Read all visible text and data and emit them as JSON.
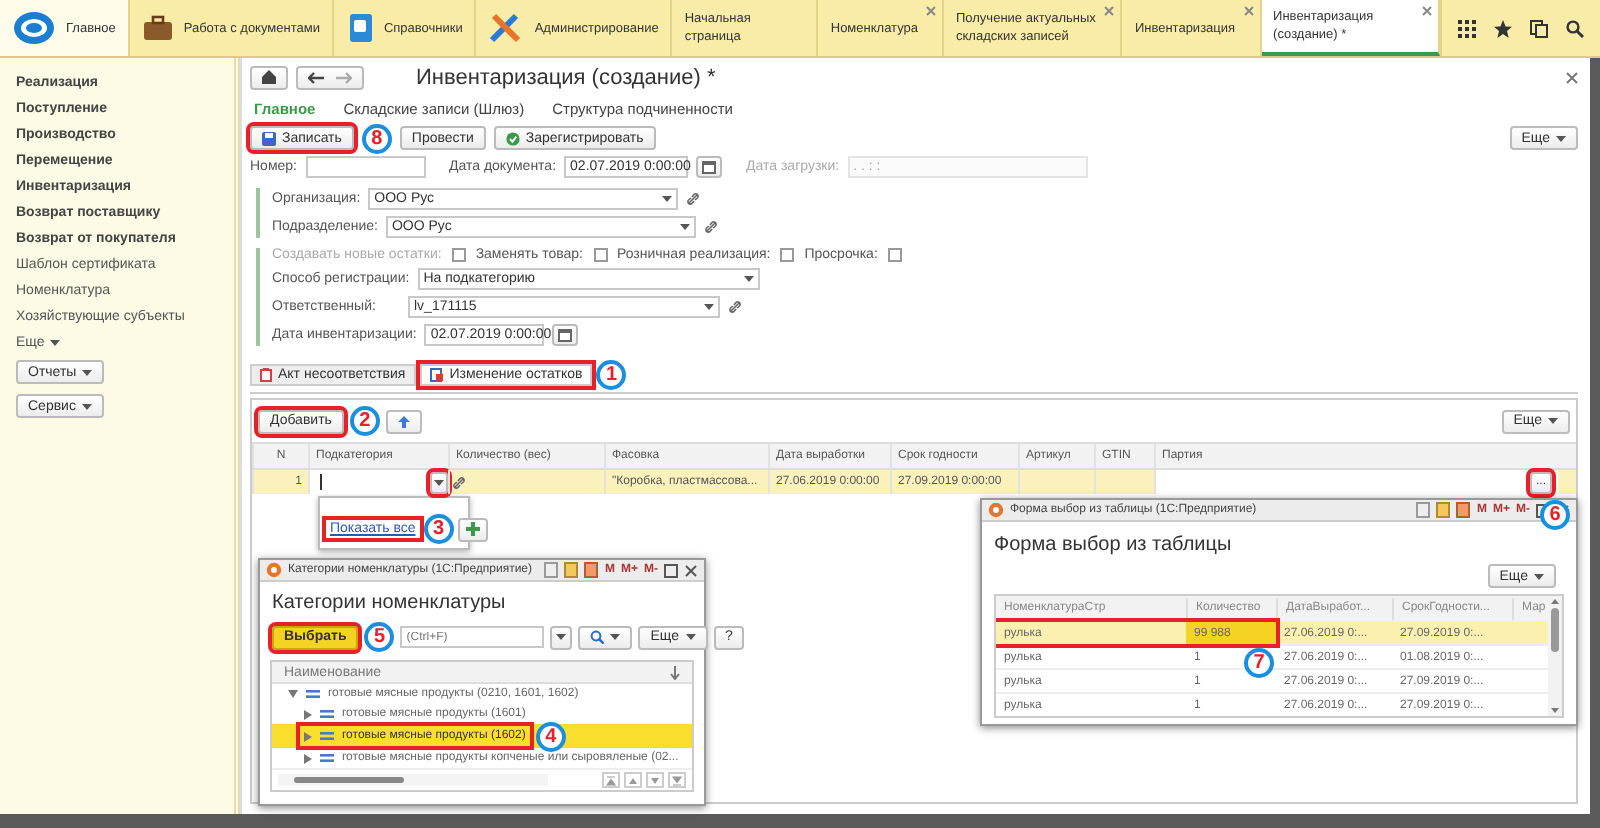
{
  "top_bar": {
    "sections": [
      {
        "label": "Главное",
        "selected": true
      },
      {
        "label": "Работа с документами",
        "selected": false
      },
      {
        "label": "Справочники",
        "selected": false
      },
      {
        "label": "Администрирование",
        "selected": false
      }
    ],
    "open_tabs": [
      {
        "label": "Начальная страница",
        "selected": false,
        "closable": false
      },
      {
        "label": "Номенклатура",
        "selected": false,
        "closable": true
      },
      {
        "label": "Получение актуальных складских записей",
        "selected": false,
        "closable": true
      },
      {
        "label": "Инвентаризация",
        "selected": false,
        "closable": true
      },
      {
        "label": "Инвентаризация (создание) *",
        "selected": true,
        "closable": true
      }
    ]
  },
  "sidebar": {
    "items": [
      {
        "label": "Реализация",
        "kind": "main"
      },
      {
        "label": "Поступление",
        "kind": "main"
      },
      {
        "label": "Производство",
        "kind": "main"
      },
      {
        "label": "Перемещение",
        "kind": "main"
      },
      {
        "label": "Инвентаризация",
        "kind": "main"
      },
      {
        "label": "Возврат поставщику",
        "kind": "main"
      },
      {
        "label": "Возврат от покупателя",
        "kind": "main"
      },
      {
        "label": "Шаблон сертификата",
        "kind": "extra"
      },
      {
        "label": "Номенклатура",
        "kind": "extra"
      },
      {
        "label": "Хозяйствующие субъекты",
        "kind": "extra"
      }
    ],
    "more": "Еще",
    "buttons": [
      "Отчеты",
      "Сервис"
    ]
  },
  "form": {
    "title": "Инвентаризация (создание) *",
    "nav_tabs": [
      {
        "label": "Главное",
        "selected": true
      },
      {
        "label": "Складские записи (Шлюз)",
        "selected": false
      },
      {
        "label": "Структура подчиненности",
        "selected": false
      }
    ],
    "toolbar": [
      {
        "label": "Записать",
        "highlighted": true,
        "callout": "8"
      },
      {
        "label": "Провести",
        "highlighted": false
      },
      {
        "label": "Зарегистрировать",
        "highlighted": false
      }
    ],
    "more": "Еще",
    "header_fields": [
      {
        "label": "Номер:",
        "kind": "text"
      },
      {
        "label": "Дата документа:",
        "value": "02.07.2019  0:00:00",
        "kind": "date"
      },
      {
        "label": "Дата загрузки:",
        "placeholder": ".  .       :  :",
        "kind": "disabled"
      }
    ],
    "organization_fields": [
      {
        "label": "Организация:",
        "value": "ООО Рус",
        "kind": "select_link"
      },
      {
        "label": "Подразделение:",
        "value": "ООО Рус",
        "kind": "select_link"
      }
    ],
    "options": [
      {
        "label": "Создавать новые остатки:",
        "checked": false,
        "disabled": true
      },
      {
        "label": "Заменять товар:",
        "checked": false,
        "disabled": false
      },
      {
        "label": "Розничная реализация:",
        "checked": false,
        "disabled": false
      },
      {
        "label": "Просрочка:",
        "checked": false,
        "disabled": false
      }
    ],
    "detail_fields": [
      {
        "label": "Способ регистрации:",
        "value": "На подкатегорию",
        "kind": "select"
      },
      {
        "label": "Ответственный:",
        "value": "lv_171115",
        "kind": "select_link"
      },
      {
        "label": "Дата инвентаризации:",
        "value": "02.07.2019  0:00:00",
        "kind": "date"
      }
    ],
    "tabs": [
      {
        "label": "Акт несоответствия",
        "selected": false,
        "highlighted": false
      },
      {
        "label": "Изменение остатков",
        "selected": true,
        "highlighted": true,
        "callout": "1"
      }
    ],
    "table": {
      "add_button": {
        "label": "Добавить",
        "highlighted": true,
        "callout": "2"
      },
      "more": "Еще",
      "columns": [
        "N",
        "Подкатегория",
        "Количество (вес)",
        "Фасовка",
        "Дата выработки",
        "Срок годности",
        "Артикул",
        "GTIN",
        "Партия"
      ],
      "rows": [
        {
          "n": "1",
          "selected": true,
          "dropdown_highlighted": true,
          "packaging": "\"Коробка, пластмассова...",
          "production_date": "27.06.2019 0:00:00",
          "expiry_date": "27.09.2019 0:00:00",
          "choice_button": {
            "label": "...",
            "highlighted": true,
            "callout": "6"
          }
        }
      ],
      "popup": {
        "link": "Показать все",
        "highlighted": true,
        "callout": "3"
      }
    }
  },
  "category_dialog": {
    "window_title": "Категории номенклатуры (1С:Предприятие)",
    "memory_buttons": [
      "M",
      "M+",
      "M-"
    ],
    "title": "Категории номенклатуры",
    "select_button": {
      "label": "Выбрать",
      "highlighted": true,
      "callout": "5"
    },
    "search_placeholder": "(Ctrl+F)",
    "more": "Еще",
    "help": "?",
    "column": "Наименование",
    "tree": [
      {
        "label": "готовые мясные продукты (0210, 1601, 1602)",
        "expanded": true,
        "selected": false,
        "highlighted": false,
        "children": [
          {
            "label": "готовые мясные продукты (1601)",
            "expanded": false,
            "selected": false,
            "highlighted": false
          },
          {
            "label": "готовые мясные продукты (1602)",
            "expanded": false,
            "selected": true,
            "highlighted": true,
            "callout": "4"
          },
          {
            "label": "готовые мясные продукты копченые или сыровяленые (02...",
            "expanded": false,
            "selected": false,
            "highlighted": false
          }
        ]
      }
    ]
  },
  "table_dialog": {
    "window_title": "Форма выбор из таблицы (1С:Предприятие)",
    "memory_buttons": [
      "M",
      "M+",
      "M-"
    ],
    "title": "Форма выбор из таблицы",
    "more": "Еще",
    "columns": [
      "НоменклатураСтр",
      "Количество",
      "ДатаВыработ...",
      "СрокГодности...",
      "Мар"
    ],
    "rows": [
      {
        "cells": [
          "рулька",
          "99 988",
          "27.06.2019 0:...",
          "27.09.2019 0:..."
        ],
        "selected": true,
        "highlighted": true,
        "callout": "7"
      },
      {
        "cells": [
          "рулька",
          "1",
          "27.06.2019 0:...",
          "01.08.2019 0:..."
        ],
        "selected": false,
        "highlighted": false
      },
      {
        "cells": [
          "рулька",
          "1",
          "27.06.2019 0:...",
          "27.09.2019 0:..."
        ],
        "selected": false,
        "highlighted": false
      },
      {
        "cells": [
          "рулька",
          "1",
          "27.06.2019 0:...",
          "27.09.2019 0:..."
        ],
        "selected": false,
        "highlighted": false
      }
    ]
  }
}
